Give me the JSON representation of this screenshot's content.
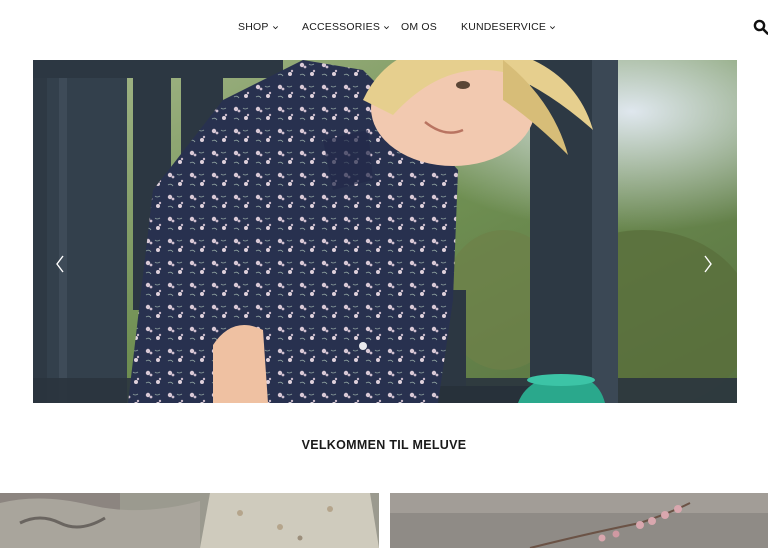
{
  "nav": {
    "items": [
      {
        "label": "SHOP",
        "has_dropdown": true
      },
      {
        "label": "ACCESSORIES",
        "has_dropdown": true
      },
      {
        "label": "OM OS",
        "has_dropdown": false
      },
      {
        "label": "KUNDESERVICE",
        "has_dropdown": true
      }
    ],
    "search_icon": "search-icon"
  },
  "hero": {
    "slide_count": 1,
    "active_slide": 1,
    "prev_icon": "chevron-left-icon",
    "next_icon": "chevron-right-icon"
  },
  "welcome": {
    "heading": "VELKOMMEN TIL MELUVE"
  },
  "tiles": [
    {
      "icon": "product-image"
    },
    {
      "icon": "product-image"
    }
  ],
  "colors": {
    "text": "#1a1a1a",
    "background": "#ffffff",
    "dress_navy": "#27304d",
    "fence": "#2e3a45",
    "toy_teal": "#2aa88c"
  }
}
